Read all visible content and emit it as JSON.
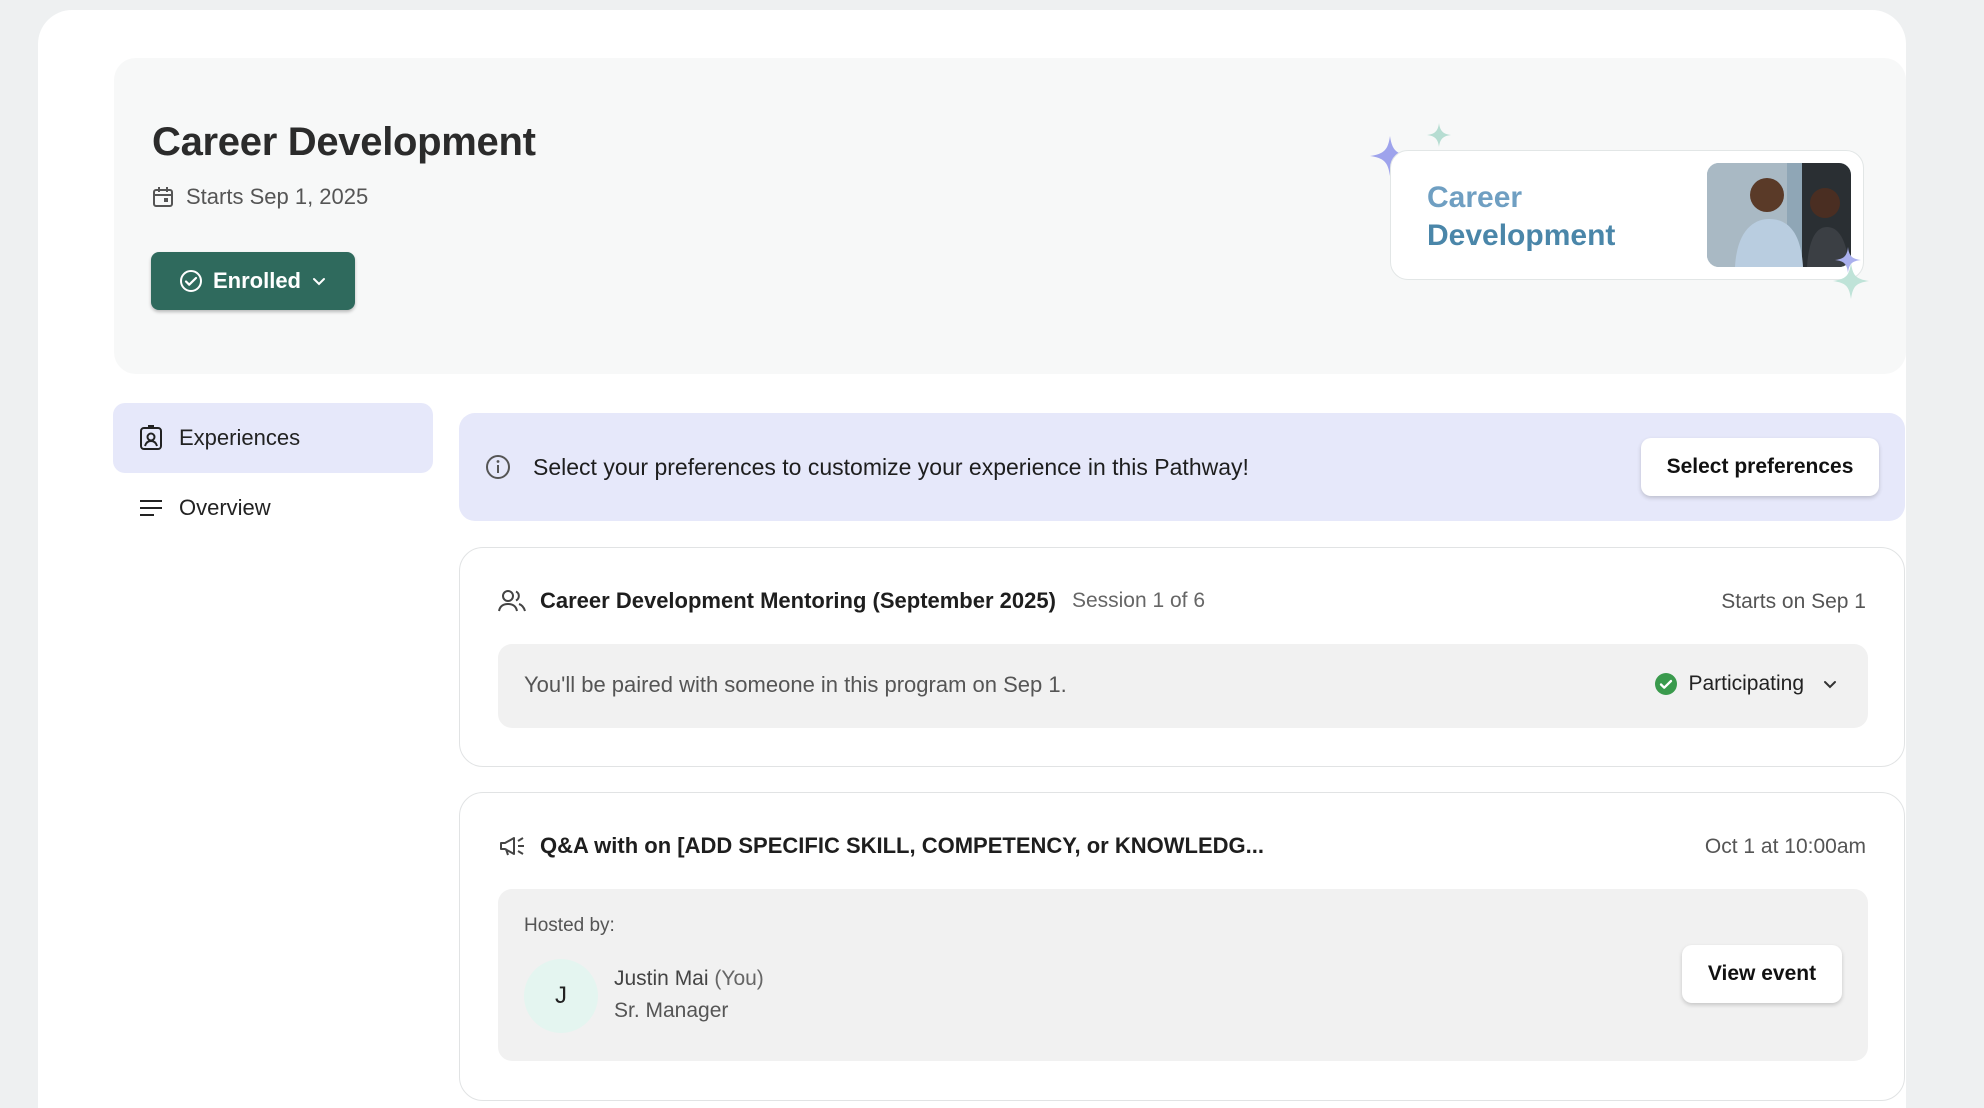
{
  "hero": {
    "title": "Career Development",
    "start_date": "Starts Sep 1, 2025",
    "enroll_status": "Enrolled",
    "promo": {
      "line1": "Career",
      "line2": "Development"
    }
  },
  "sidebar": {
    "items": [
      {
        "label": "Experiences",
        "icon": "badge-icon",
        "active": true
      },
      {
        "label": "Overview",
        "icon": "lines-icon",
        "active": false
      }
    ]
  },
  "banner": {
    "message": "Select your preferences to customize your experience in this Pathway!",
    "button": "Select preferences"
  },
  "experiences": [
    {
      "icon": "people-icon",
      "title": "Career Development Mentoring (September 2025)",
      "subtitle": "Session 1 of 6",
      "right": "Starts on Sep 1",
      "body_text": "You'll be paired with someone in this program on Sep 1.",
      "status": "Participating"
    },
    {
      "icon": "megaphone-icon",
      "title": "Q&A with on [ADD SPECIFIC SKILL, COMPETENCY, or KNOWLEDG...",
      "right": "Oct 1 at 10:00am",
      "hosted_label": "Hosted by:",
      "host": {
        "initial": "J",
        "name": "Justin Mai",
        "you": "(You)",
        "role": "Sr. Manager"
      },
      "button": "View event"
    }
  ],
  "colors": {
    "accent_green": "#2f6a5d",
    "active_bg": "#e6e8fa",
    "status_green": "#3a9a4d"
  }
}
